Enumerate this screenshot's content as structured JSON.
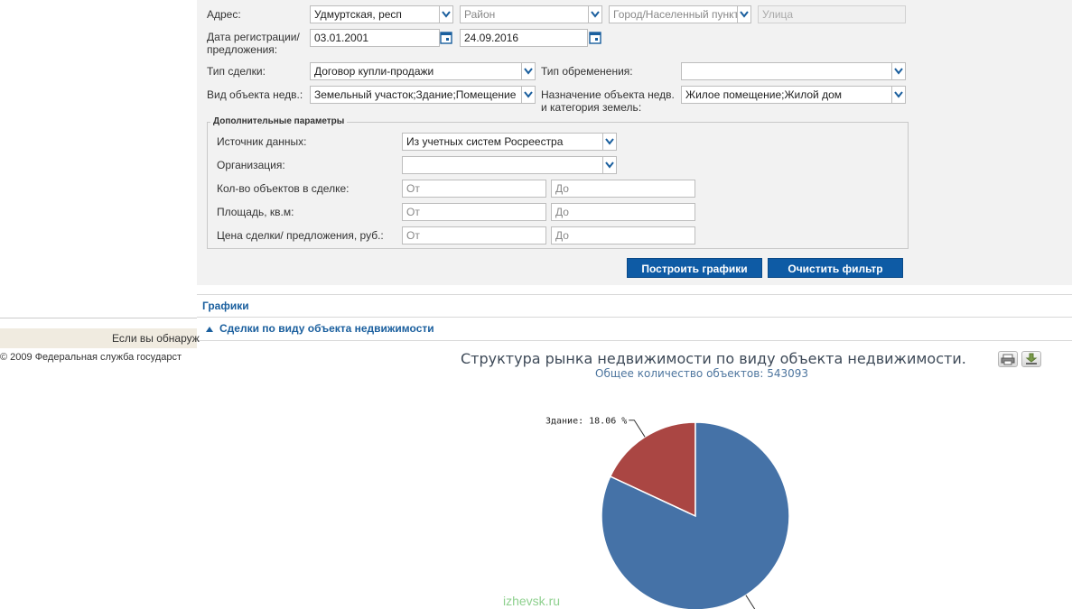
{
  "form": {
    "address_label": "Адрес:",
    "region_value": "Удмуртская, респ",
    "district_placeholder": "Район",
    "city_placeholder": "Город/Населенный пункт",
    "street_placeholder": "Улица",
    "reg_date_label_1": "Дата регистрации/",
    "reg_date_label_2": "предложения:",
    "date_from": "03.01.2001",
    "date_to": "24.09.2016",
    "deal_type_label": "Тип сделки:",
    "deal_type_value": "Договор купли-продажи",
    "encumbrance_label": "Тип обременения:",
    "encumbrance_value": "",
    "object_type_label": "Вид объекта недв.:",
    "object_type_value": "Земельный участок;Здание;Помещение",
    "purpose_label_1": "Назначение объекта недв.",
    "purpose_label_2": "и категория земель:",
    "purpose_value": "Жилое помещение;Жилой дом"
  },
  "extra": {
    "legend": "Дополнительные параметры",
    "source_label": "Источник данных:",
    "source_value": "Из учетных систем Росреестра",
    "org_label": "Организация:",
    "org_value": "",
    "count_label": "Кол-во объектов в сделке:",
    "area_label": "Площадь, кв.м:",
    "price_label": "Цена сделки/ предложения, руб.:",
    "from_placeholder": "От",
    "to_placeholder": "До"
  },
  "buttons": {
    "build": "Построить графики",
    "clear": "Очистить фильтр"
  },
  "sections": {
    "charts": "Графики",
    "by_type": "Сделки по виду объекта недвижимости"
  },
  "left": {
    "notice": "Если вы обнаруж",
    "copyright": "© 2009 Федеральная служба государст"
  },
  "chart_data": {
    "type": "pie",
    "title": "Структура рынка недвижимости по виду объекта недвижимости.",
    "subtitle": "Общее количество объектов: 543093",
    "slices": [
      {
        "name": "Здание",
        "value": 18.06,
        "label": "Здание: 18.06 %",
        "color": "#aa4643"
      },
      {
        "name": "",
        "value": 81.94,
        "label": "",
        "color": "#4572a7"
      }
    ]
  },
  "watermark": "izhevsk.ru"
}
